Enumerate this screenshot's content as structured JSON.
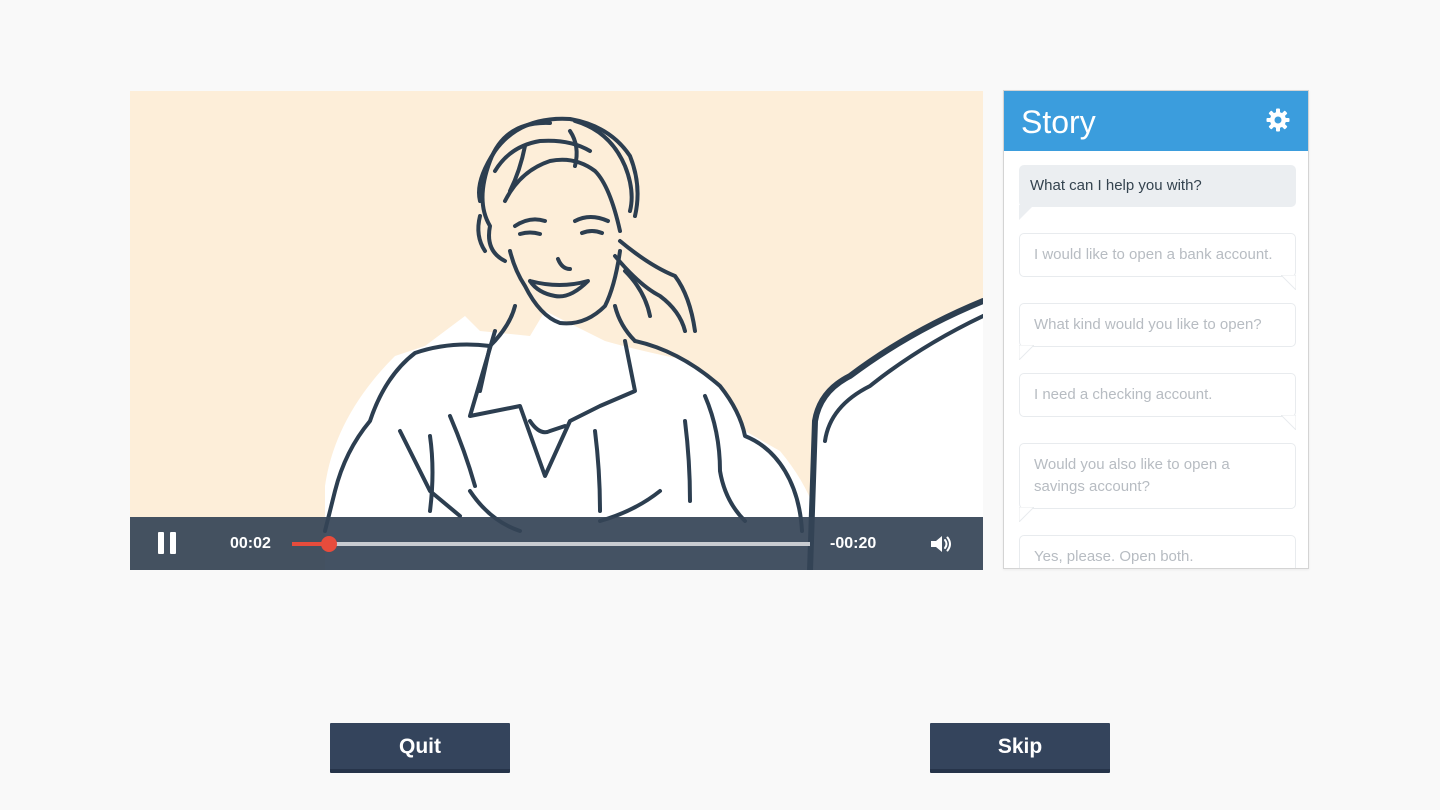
{
  "player": {
    "elapsed": "00:02",
    "remaining": "-00:20",
    "progress_fraction": 0.072
  },
  "story": {
    "title": "Story",
    "messages": [
      {
        "speaker": "agent",
        "text": "What can I help you with?",
        "active": true
      },
      {
        "speaker": "customer",
        "text": "I would like to open a bank account.",
        "active": false
      },
      {
        "speaker": "agent",
        "text": "What kind would you like to open?",
        "active": false
      },
      {
        "speaker": "customer",
        "text": "I need a checking account.",
        "active": false
      },
      {
        "speaker": "agent",
        "text": "Would you also like to open a savings account?",
        "active": false
      },
      {
        "speaker": "customer",
        "text": "Yes, please. Open both.",
        "active": false
      }
    ]
  },
  "buttons": {
    "quit_label": "Quit",
    "skip_label": "Skip"
  },
  "colors": {
    "accent": "#3b9ddd",
    "progress": "#e74c3c",
    "controls_bg": "#344356",
    "button_bg": "#34445c",
    "video_bg": "#fdeed9"
  }
}
